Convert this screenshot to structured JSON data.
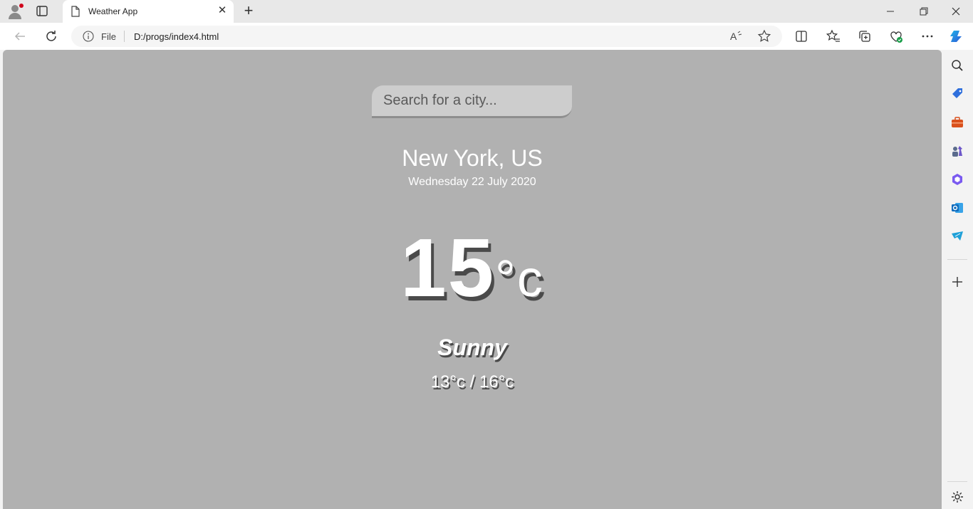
{
  "browser": {
    "tab_title": "Weather App",
    "address": {
      "scheme_label": "File",
      "url": "D:/progs/index4.html"
    },
    "icons": {
      "back": "back-arrow-icon",
      "refresh": "refresh-icon",
      "read_aloud": "read-aloud-icon",
      "favorite": "star-icon",
      "split_screen": "split-screen-icon",
      "favorites": "favorites-icon",
      "collections": "collections-icon",
      "browser_essentials": "heart-shield-icon",
      "more": "more-icon",
      "copilot": "copilot-icon"
    },
    "sidebar_icons": [
      "search-icon",
      "shopping-tag-icon",
      "tools-icon",
      "games-icon",
      "office-icon",
      "outlook-icon",
      "telegram-icon",
      "add-icon",
      "settings-icon"
    ]
  },
  "app": {
    "search_placeholder": "Search for a city...",
    "city": "New York, US",
    "date": "Wednesday 22 July 2020",
    "temperature": "15",
    "temperature_unit": "°c",
    "weather": "Sunny",
    "hi_low": "13°c / 16°c"
  },
  "colors": {
    "page_background": "#b1b1b1",
    "search_background": "#cdcdcd",
    "text": "#ffffff",
    "text_shadow": "#4a4a4a"
  }
}
